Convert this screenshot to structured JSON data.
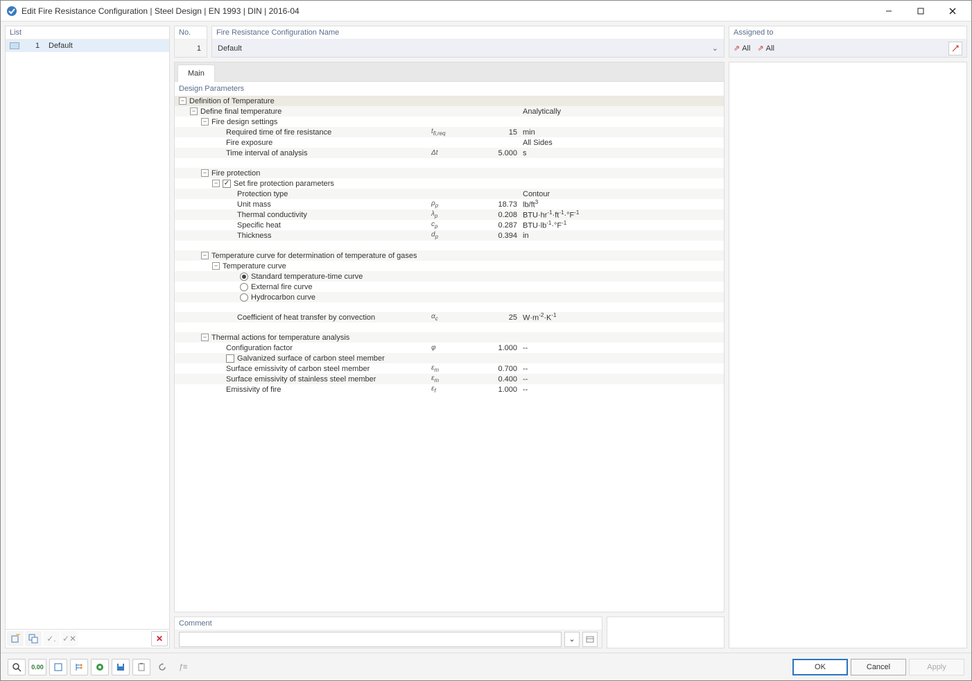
{
  "titlebar": {
    "title": "Edit Fire Resistance Configuration | Steel Design | EN 1993 | DIN | 2016-04"
  },
  "left": {
    "header": "List",
    "items": [
      {
        "num": "1",
        "label": "Default"
      }
    ]
  },
  "no_panel": {
    "header": "No.",
    "value": "1"
  },
  "name_panel": {
    "header": "Fire Resistance Configuration Name",
    "value": "Default"
  },
  "assigned": {
    "header": "Assigned to",
    "items": [
      {
        "icon": "member-icon",
        "label": "All"
      },
      {
        "icon": "set-icon",
        "label": "All"
      }
    ]
  },
  "tabs": {
    "main": "Main"
  },
  "params": {
    "title": "Design Parameters",
    "def_temp": "Definition of Temperature",
    "def_final_temp": "Define final temperature",
    "def_final_temp_val": "Analytically",
    "fire_settings": "Fire design settings",
    "req_time": {
      "label": "Required time of fire resistance",
      "sym": "tfi,req",
      "val": "15",
      "unit": "min"
    },
    "fire_exposure": {
      "label": "Fire exposure",
      "val": "All Sides"
    },
    "interval": {
      "label": "Time interval of analysis",
      "sym": "Δt",
      "val": "5.000",
      "unit": "s"
    },
    "fire_protection": "Fire protection",
    "set_fire_params": "Set fire protection parameters",
    "protection_type": {
      "label": "Protection type",
      "val": "Contour"
    },
    "unit_mass": {
      "label": "Unit mass",
      "sym": "ρp",
      "val": "18.73",
      "unit": "lb/ft³"
    },
    "thermal_cond": {
      "label": "Thermal conductivity",
      "sym": "λp",
      "val": "0.208",
      "unit": "BTU·hr⁻¹·ft⁻¹·°F⁻¹"
    },
    "specific_heat": {
      "label": "Specific heat",
      "sym": "cp",
      "val": "0.287",
      "unit": "BTU·lb⁻¹·°F⁻¹"
    },
    "thickness": {
      "label": "Thickness",
      "sym": "dp",
      "val": "0.394",
      "unit": "in"
    },
    "temp_curve_hdr": "Temperature curve for determination of temperature of gases",
    "temp_curve": "Temperature curve",
    "curve_std": "Standard temperature-time curve",
    "curve_ext": "External fire curve",
    "curve_hydro": "Hydrocarbon curve",
    "coef_heat": {
      "label": "Coefficient of heat transfer by convection",
      "sym": "αc",
      "val": "25",
      "unit": "W·m⁻²·K⁻¹"
    },
    "thermal_actions": "Thermal actions for temperature analysis",
    "config_factor": {
      "label": "Configuration factor",
      "sym": "φ",
      "val": "1.000",
      "unit": "--"
    },
    "galvanized": "Galvanized surface of carbon steel member",
    "emiss_carbon": {
      "label": "Surface emissivity of carbon steel member",
      "sym": "εm",
      "val": "0.700",
      "unit": "--"
    },
    "emiss_stainless": {
      "label": "Surface emissivity of stainless steel member",
      "sym": "εm",
      "val": "0.400",
      "unit": "--"
    },
    "emiss_fire": {
      "label": "Emissivity of fire",
      "sym": "εf",
      "val": "1.000",
      "unit": "--"
    }
  },
  "comment": {
    "header": "Comment"
  },
  "footer": {
    "ok": "OK",
    "cancel": "Cancel",
    "apply": "Apply"
  }
}
